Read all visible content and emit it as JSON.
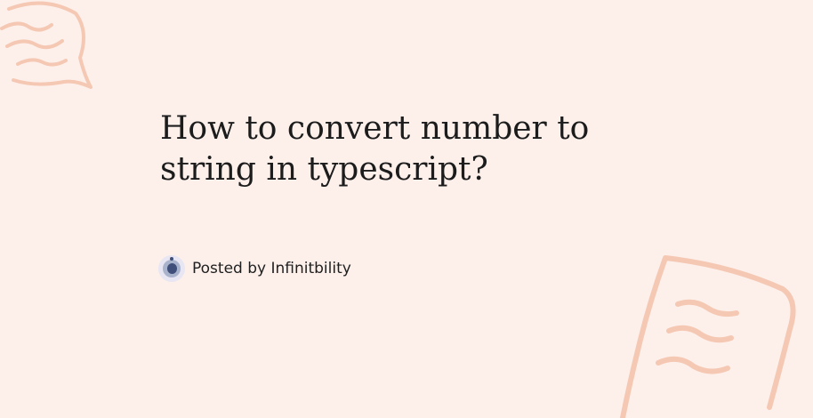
{
  "post": {
    "title": "How to convert number to string in typescript?",
    "posted_by_prefix": "Posted by",
    "author": "Infinitbility"
  },
  "icons": {
    "decoration_top_left": "speech-bubble-doodle-icon",
    "decoration_bottom_right": "note-card-doodle-icon",
    "avatar": "author-avatar-icon"
  },
  "colors": {
    "background": "#fdf0eb",
    "doodle": "#f5c8b4",
    "title_text": "#1c1c1c",
    "avatar_core": "#3f4f7a"
  }
}
